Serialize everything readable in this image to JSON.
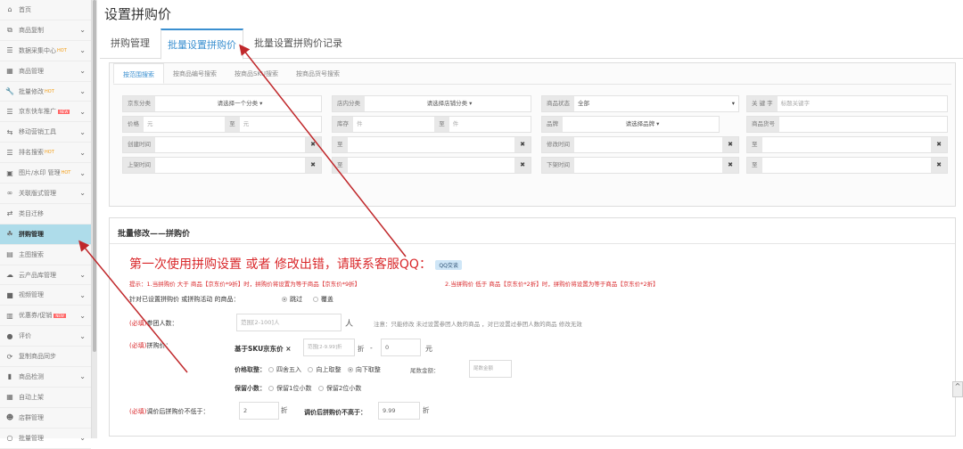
{
  "sidebar": {
    "items": [
      {
        "icon": "home-icon",
        "glyph": "⌂",
        "label": "首页",
        "chev": false
      },
      {
        "icon": "copy-icon",
        "glyph": "⧉",
        "label": "商品复制",
        "chev": true
      },
      {
        "icon": "list-icon",
        "glyph": "☰",
        "label": "数据采集中心",
        "badge": "HOT",
        "chev": true
      },
      {
        "icon": "grid-icon",
        "glyph": "▦",
        "label": "商品管理",
        "chev": true
      },
      {
        "icon": "wrench-icon",
        "glyph": "🔧",
        "label": "批量修改",
        "badge": "HOT",
        "chev": true
      },
      {
        "icon": "list-icon",
        "glyph": "☰",
        "label": "京东快车推广",
        "badge": "NEW",
        "chev": true
      },
      {
        "icon": "sliders-icon",
        "glyph": "⇆",
        "label": "移动营销工具",
        "chev": true
      },
      {
        "icon": "list-icon",
        "glyph": "☰",
        "label": "排名搜索",
        "badge": "HOT",
        "chev": true
      },
      {
        "icon": "image-icon",
        "glyph": "▣",
        "label": "图片/水印 管理",
        "badge": "HOT",
        "chev": true
      },
      {
        "icon": "link-icon",
        "glyph": "∞",
        "label": "关联版式管理",
        "chev": true
      },
      {
        "icon": "exchange-icon",
        "glyph": "⇄",
        "label": "类目迁移",
        "chev": false
      },
      {
        "icon": "group-icon",
        "glyph": "☘",
        "label": "拼购管理",
        "chev": false,
        "active": true
      },
      {
        "icon": "image-search-icon",
        "glyph": "▤",
        "label": "主图搜索",
        "chev": false
      },
      {
        "icon": "cloud-icon",
        "glyph": "☁",
        "label": "云产品库管理",
        "chev": true
      },
      {
        "icon": "video-icon",
        "glyph": "■",
        "label": "视频管理",
        "chev": true
      },
      {
        "icon": "coupon-icon",
        "glyph": "▥",
        "label": "优惠券/促销",
        "badge": "NEW",
        "chev": true
      },
      {
        "icon": "comment-icon",
        "glyph": "●",
        "label": "评价",
        "chev": true
      },
      {
        "icon": "sync-icon",
        "glyph": "⟳",
        "label": "复制商品同步",
        "chev": false
      },
      {
        "icon": "barcode-icon",
        "glyph": "▮",
        "label": "商品检测",
        "chev": true
      },
      {
        "icon": "calendar-icon",
        "glyph": "▦",
        "label": "自动上架",
        "chev": false
      },
      {
        "icon": "users-icon",
        "glyph": "☻",
        "label": "店群管理",
        "chev": false
      },
      {
        "icon": "search-icon",
        "glyph": "○",
        "label": "批量管理",
        "chev": true
      }
    ]
  },
  "page_title": "设置拼购价",
  "tabs": [
    "拼购管理",
    "批量设置拼购价",
    "批量设置拼购价记录"
  ],
  "search": {
    "tabs": [
      "按范围搜索",
      "按商品编号搜索",
      "按商品SKU搜索",
      "按商品货号搜索"
    ],
    "jd_category": {
      "label": "京东分类",
      "value": "请选择一个分类 ▾"
    },
    "shop_category": {
      "label": "店内分类",
      "value": "请选择店铺分类 ▾"
    },
    "status": {
      "label": "商品状态",
      "value": "全部"
    },
    "keyword": {
      "label": "关 键 字",
      "placeholder": "标题关键字"
    },
    "price": {
      "label": "价格",
      "unit": "元",
      "to": "至"
    },
    "stock": {
      "label": "库存",
      "unit": "件",
      "to": "至"
    },
    "brand": {
      "label": "品牌",
      "value": "请选择品牌 ▾"
    },
    "item_no": {
      "label": "商品货号"
    },
    "created": {
      "label": "创建时间",
      "to": "至"
    },
    "modified": {
      "label": "修改时间",
      "to": "至"
    },
    "listed": {
      "label": "上架时间",
      "to": "至"
    },
    "delisted": {
      "label": "下架时间",
      "to": "至"
    },
    "clear": "✖"
  },
  "batch": {
    "header": "批量修改——拼购价",
    "notice": "第一次使用拼购设置 或者 修改出错，请联系客服QQ：",
    "qq_button": "QQ交谈",
    "hint1": "提示：1.当拼购价 大于 商品【京东价*9折】时，拼购价将设置为等于商品【京东价*9折】",
    "hint2": "2.当拼购价 低于 商品【京东价*2折】时，拼购价将设置为等于商品【京东价*2折】",
    "existing_label": "针对已设置拼购价 或拼购活动 的商品：",
    "skip": "跳过",
    "overwrite": "覆盖",
    "required": "(必填)",
    "group_size_label": "参团人数：",
    "group_size_placeholder": "范围[2-100]人",
    "group_size_unit": "人",
    "group_size_note": "注意：只能修改 未过设置参团人数的商品 ，对已设置过参团人数的商品 修改无效",
    "price_label": "拼购价：",
    "based_on": "基于SKU京东价 ×",
    "discount_placeholder": "范围[2-9.99]折",
    "discount_unit": "折",
    "minus": "-",
    "minus_value": "0",
    "yuan": "元",
    "rounding_label": "价格取整：",
    "rounding": [
      "四舍五入",
      "向上取整",
      "向下取整"
    ],
    "tail_label": "尾数金额：",
    "tail_placeholder": "尾数金额",
    "decimals_label": "保留小数：",
    "decimals": [
      "保留1位小数",
      "保留2位小数"
    ],
    "min_label": "调价后拼购价不低于：",
    "min_value": "2",
    "max_label": "调价后拼购价不高于：",
    "max_value": "9.99",
    "zhe": "折"
  },
  "colors": {
    "accent": "#3a8fd0",
    "alert": "#d9282b",
    "active_sidebar": "#aedcea",
    "arrow": "#c0282b"
  }
}
